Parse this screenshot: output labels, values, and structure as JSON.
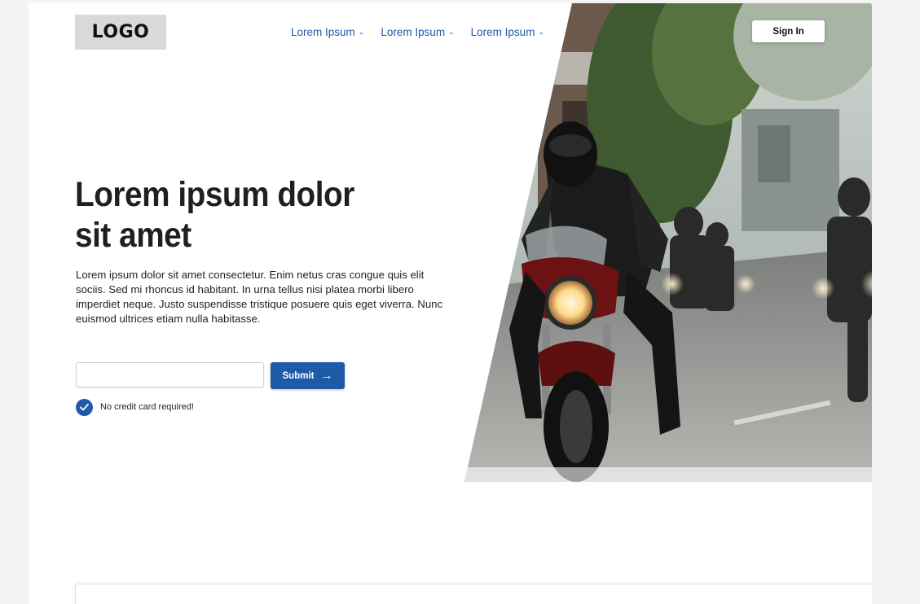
{
  "header": {
    "logo": "LOGO",
    "nav": [
      {
        "label": "Lorem Ipsum",
        "icon": "chevron-down-icon"
      },
      {
        "label": "Lorem Ipsum",
        "icon": "chevron-down-icon"
      },
      {
        "label": "Lorem Ipsum",
        "icon": "chevron-down-icon"
      }
    ],
    "sign_in_label": "Sign In"
  },
  "hero": {
    "title_line1": "Lorem ipsum dolor",
    "title_line2": "sit amet",
    "body": "Lorem ipsum dolor sit amet consectetur. Enim netus cras congue quis elit sociis. Sed mi rhoncus id habitant. In urna tellus nisi platea morbi libero imperdiet neque. Justo suspendisse tristique posuere quis eget viverra. Nunc euismod ultrices etiam nulla habitasse.",
    "email_placeholder": "",
    "submit_label": "Submit",
    "submit_icon": "arrow-right-icon",
    "check_icon": "check-circle-icon",
    "note": "No credit card required!"
  },
  "colors": {
    "accent": "#1f5aa8",
    "page_bg": "#f4f4f5",
    "logo_bg": "#d9d9d9"
  }
}
